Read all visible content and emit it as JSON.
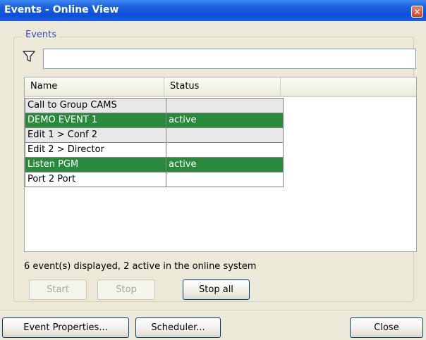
{
  "window": {
    "title": "Events - Online View",
    "close_glyph": "✕"
  },
  "group": {
    "legend": "Events"
  },
  "filter": {
    "icon": "filter-icon",
    "value": ""
  },
  "table": {
    "columns": [
      "Name",
      "Status"
    ],
    "rows": [
      {
        "name": "Call to Group CAMS",
        "status": ""
      },
      {
        "name": "DEMO EVENT 1",
        "status": "active"
      },
      {
        "name": "Edit 1 > Conf 2",
        "status": ""
      },
      {
        "name": "Edit 2 > Director",
        "status": ""
      },
      {
        "name": "Listen PGM",
        "status": "active"
      },
      {
        "name": "Port 2 Port",
        "status": ""
      }
    ]
  },
  "summary": "6 event(s) displayed, 2 active in the online system",
  "buttons": {
    "start": "Start",
    "stop": "Stop",
    "stop_all": "Stop all",
    "event_properties": "Event Properties...",
    "scheduler": "Scheduler...",
    "close": "Close"
  },
  "colors": {
    "active_row": "#2a8a3c",
    "title_bar": "#0b4fd6"
  }
}
